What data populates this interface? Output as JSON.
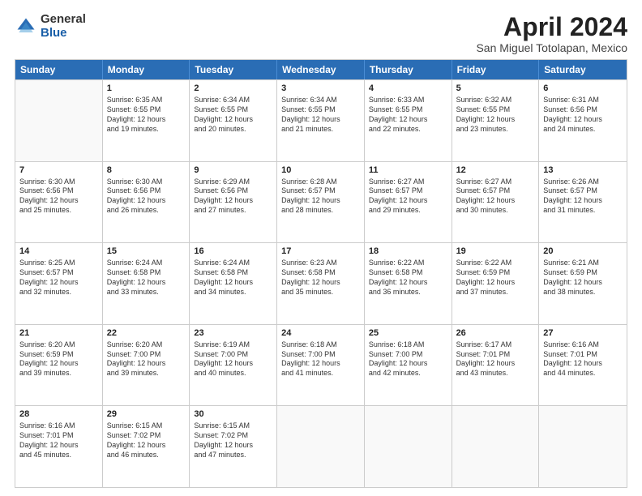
{
  "logo": {
    "general": "General",
    "blue": "Blue"
  },
  "title": "April 2024",
  "location": "San Miguel Totolapan, Mexico",
  "header_days": [
    "Sunday",
    "Monday",
    "Tuesday",
    "Wednesday",
    "Thursday",
    "Friday",
    "Saturday"
  ],
  "weeks": [
    [
      {
        "day": "",
        "empty": true,
        "lines": []
      },
      {
        "day": "1",
        "empty": false,
        "lines": [
          "Sunrise: 6:35 AM",
          "Sunset: 6:55 PM",
          "Daylight: 12 hours",
          "and 19 minutes."
        ]
      },
      {
        "day": "2",
        "empty": false,
        "lines": [
          "Sunrise: 6:34 AM",
          "Sunset: 6:55 PM",
          "Daylight: 12 hours",
          "and 20 minutes."
        ]
      },
      {
        "day": "3",
        "empty": false,
        "lines": [
          "Sunrise: 6:34 AM",
          "Sunset: 6:55 PM",
          "Daylight: 12 hours",
          "and 21 minutes."
        ]
      },
      {
        "day": "4",
        "empty": false,
        "lines": [
          "Sunrise: 6:33 AM",
          "Sunset: 6:55 PM",
          "Daylight: 12 hours",
          "and 22 minutes."
        ]
      },
      {
        "day": "5",
        "empty": false,
        "lines": [
          "Sunrise: 6:32 AM",
          "Sunset: 6:55 PM",
          "Daylight: 12 hours",
          "and 23 minutes."
        ]
      },
      {
        "day": "6",
        "empty": false,
        "lines": [
          "Sunrise: 6:31 AM",
          "Sunset: 6:56 PM",
          "Daylight: 12 hours",
          "and 24 minutes."
        ]
      }
    ],
    [
      {
        "day": "7",
        "empty": false,
        "lines": [
          "Sunrise: 6:30 AM",
          "Sunset: 6:56 PM",
          "Daylight: 12 hours",
          "and 25 minutes."
        ]
      },
      {
        "day": "8",
        "empty": false,
        "lines": [
          "Sunrise: 6:30 AM",
          "Sunset: 6:56 PM",
          "Daylight: 12 hours",
          "and 26 minutes."
        ]
      },
      {
        "day": "9",
        "empty": false,
        "lines": [
          "Sunrise: 6:29 AM",
          "Sunset: 6:56 PM",
          "Daylight: 12 hours",
          "and 27 minutes."
        ]
      },
      {
        "day": "10",
        "empty": false,
        "lines": [
          "Sunrise: 6:28 AM",
          "Sunset: 6:57 PM",
          "Daylight: 12 hours",
          "and 28 minutes."
        ]
      },
      {
        "day": "11",
        "empty": false,
        "lines": [
          "Sunrise: 6:27 AM",
          "Sunset: 6:57 PM",
          "Daylight: 12 hours",
          "and 29 minutes."
        ]
      },
      {
        "day": "12",
        "empty": false,
        "lines": [
          "Sunrise: 6:27 AM",
          "Sunset: 6:57 PM",
          "Daylight: 12 hours",
          "and 30 minutes."
        ]
      },
      {
        "day": "13",
        "empty": false,
        "lines": [
          "Sunrise: 6:26 AM",
          "Sunset: 6:57 PM",
          "Daylight: 12 hours",
          "and 31 minutes."
        ]
      }
    ],
    [
      {
        "day": "14",
        "empty": false,
        "lines": [
          "Sunrise: 6:25 AM",
          "Sunset: 6:57 PM",
          "Daylight: 12 hours",
          "and 32 minutes."
        ]
      },
      {
        "day": "15",
        "empty": false,
        "lines": [
          "Sunrise: 6:24 AM",
          "Sunset: 6:58 PM",
          "Daylight: 12 hours",
          "and 33 minutes."
        ]
      },
      {
        "day": "16",
        "empty": false,
        "lines": [
          "Sunrise: 6:24 AM",
          "Sunset: 6:58 PM",
          "Daylight: 12 hours",
          "and 34 minutes."
        ]
      },
      {
        "day": "17",
        "empty": false,
        "lines": [
          "Sunrise: 6:23 AM",
          "Sunset: 6:58 PM",
          "Daylight: 12 hours",
          "and 35 minutes."
        ]
      },
      {
        "day": "18",
        "empty": false,
        "lines": [
          "Sunrise: 6:22 AM",
          "Sunset: 6:58 PM",
          "Daylight: 12 hours",
          "and 36 minutes."
        ]
      },
      {
        "day": "19",
        "empty": false,
        "lines": [
          "Sunrise: 6:22 AM",
          "Sunset: 6:59 PM",
          "Daylight: 12 hours",
          "and 37 minutes."
        ]
      },
      {
        "day": "20",
        "empty": false,
        "lines": [
          "Sunrise: 6:21 AM",
          "Sunset: 6:59 PM",
          "Daylight: 12 hours",
          "and 38 minutes."
        ]
      }
    ],
    [
      {
        "day": "21",
        "empty": false,
        "lines": [
          "Sunrise: 6:20 AM",
          "Sunset: 6:59 PM",
          "Daylight: 12 hours",
          "and 39 minutes."
        ]
      },
      {
        "day": "22",
        "empty": false,
        "lines": [
          "Sunrise: 6:20 AM",
          "Sunset: 7:00 PM",
          "Daylight: 12 hours",
          "and 39 minutes."
        ]
      },
      {
        "day": "23",
        "empty": false,
        "lines": [
          "Sunrise: 6:19 AM",
          "Sunset: 7:00 PM",
          "Daylight: 12 hours",
          "and 40 minutes."
        ]
      },
      {
        "day": "24",
        "empty": false,
        "lines": [
          "Sunrise: 6:18 AM",
          "Sunset: 7:00 PM",
          "Daylight: 12 hours",
          "and 41 minutes."
        ]
      },
      {
        "day": "25",
        "empty": false,
        "lines": [
          "Sunrise: 6:18 AM",
          "Sunset: 7:00 PM",
          "Daylight: 12 hours",
          "and 42 minutes."
        ]
      },
      {
        "day": "26",
        "empty": false,
        "lines": [
          "Sunrise: 6:17 AM",
          "Sunset: 7:01 PM",
          "Daylight: 12 hours",
          "and 43 minutes."
        ]
      },
      {
        "day": "27",
        "empty": false,
        "lines": [
          "Sunrise: 6:16 AM",
          "Sunset: 7:01 PM",
          "Daylight: 12 hours",
          "and 44 minutes."
        ]
      }
    ],
    [
      {
        "day": "28",
        "empty": false,
        "lines": [
          "Sunrise: 6:16 AM",
          "Sunset: 7:01 PM",
          "Daylight: 12 hours",
          "and 45 minutes."
        ]
      },
      {
        "day": "29",
        "empty": false,
        "lines": [
          "Sunrise: 6:15 AM",
          "Sunset: 7:02 PM",
          "Daylight: 12 hours",
          "and 46 minutes."
        ]
      },
      {
        "day": "30",
        "empty": false,
        "lines": [
          "Sunrise: 6:15 AM",
          "Sunset: 7:02 PM",
          "Daylight: 12 hours",
          "and 47 minutes."
        ]
      },
      {
        "day": "",
        "empty": true,
        "lines": []
      },
      {
        "day": "",
        "empty": true,
        "lines": []
      },
      {
        "day": "",
        "empty": true,
        "lines": []
      },
      {
        "day": "",
        "empty": true,
        "lines": []
      }
    ]
  ]
}
